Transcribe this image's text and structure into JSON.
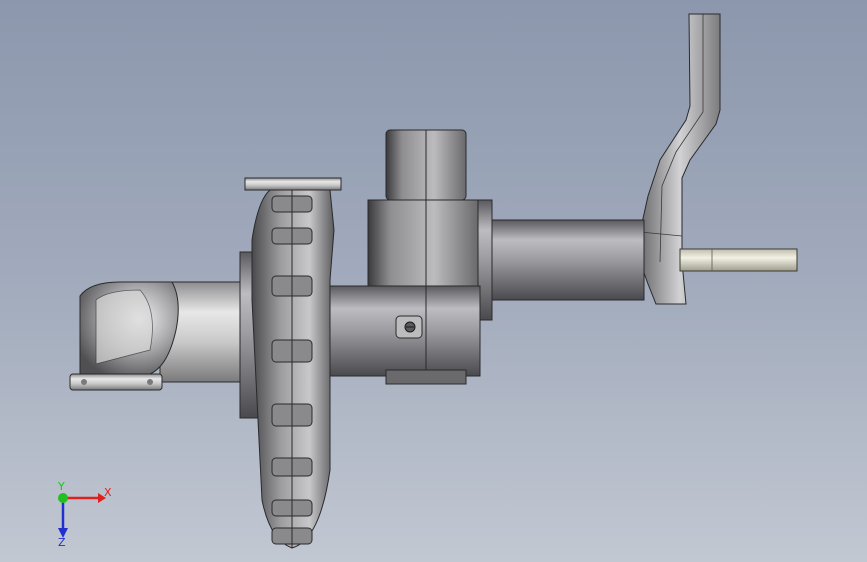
{
  "viewport": {
    "background_top": "#8c97ad",
    "background_bottom": "#c2c8d2"
  },
  "model": {
    "parts": [
      "inlet-elbow",
      "pump-volute",
      "motor-housing",
      "shaft-tube",
      "mounting-bracket",
      "drive-shaft"
    ]
  },
  "triad": {
    "x_label": "X",
    "y_label": "Y",
    "z_label": "Z",
    "x_color": "#e0201c",
    "y_color": "#20c020",
    "z_color": "#2030d0"
  }
}
